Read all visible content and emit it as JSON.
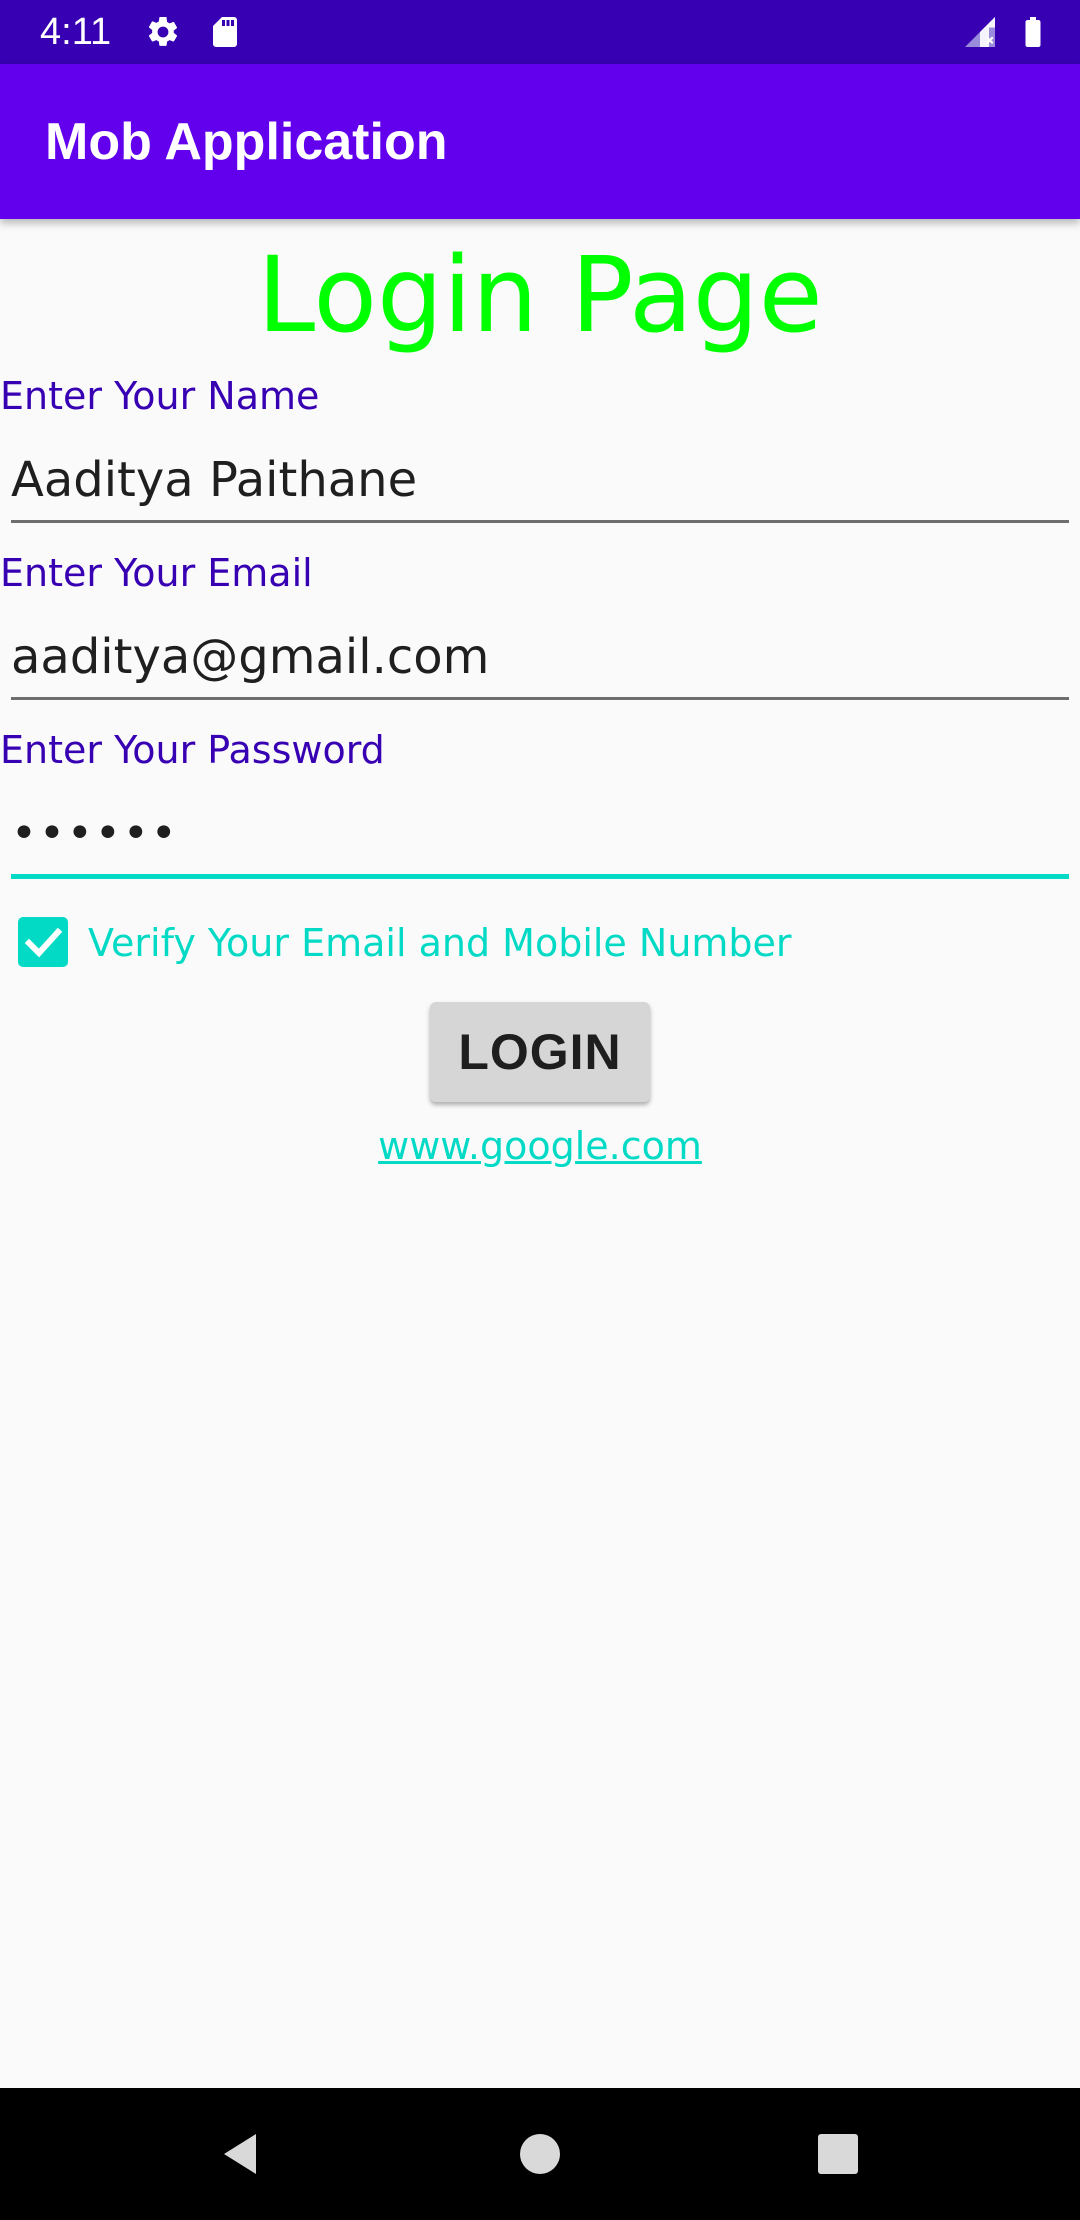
{
  "status_bar": {
    "time": "4:11",
    "icons": [
      "gear-icon",
      "sd-card-icon",
      "signal-icon",
      "battery-icon"
    ]
  },
  "app_bar": {
    "title": "Mob Application",
    "color": "#6200ee"
  },
  "form": {
    "heading": "Login Page",
    "name_label": "Enter Your Name",
    "name_value": "Aaditya Paithane",
    "email_label": "Enter Your Email",
    "email_value": "aaditya@gmail.com",
    "password_label": "Enter Your Password",
    "password_value": "••••••",
    "verify_label": "Verify Your Email and Mobile Number",
    "verify_checked": true,
    "login_label": "LOGIN",
    "link_text": "www.google.com"
  },
  "colors": {
    "heading": "#00ff00",
    "label": "#3700b3",
    "accent": "#03dac5"
  },
  "nav_bar": {
    "icons": [
      "back-icon",
      "home-icon",
      "recents-icon"
    ]
  }
}
